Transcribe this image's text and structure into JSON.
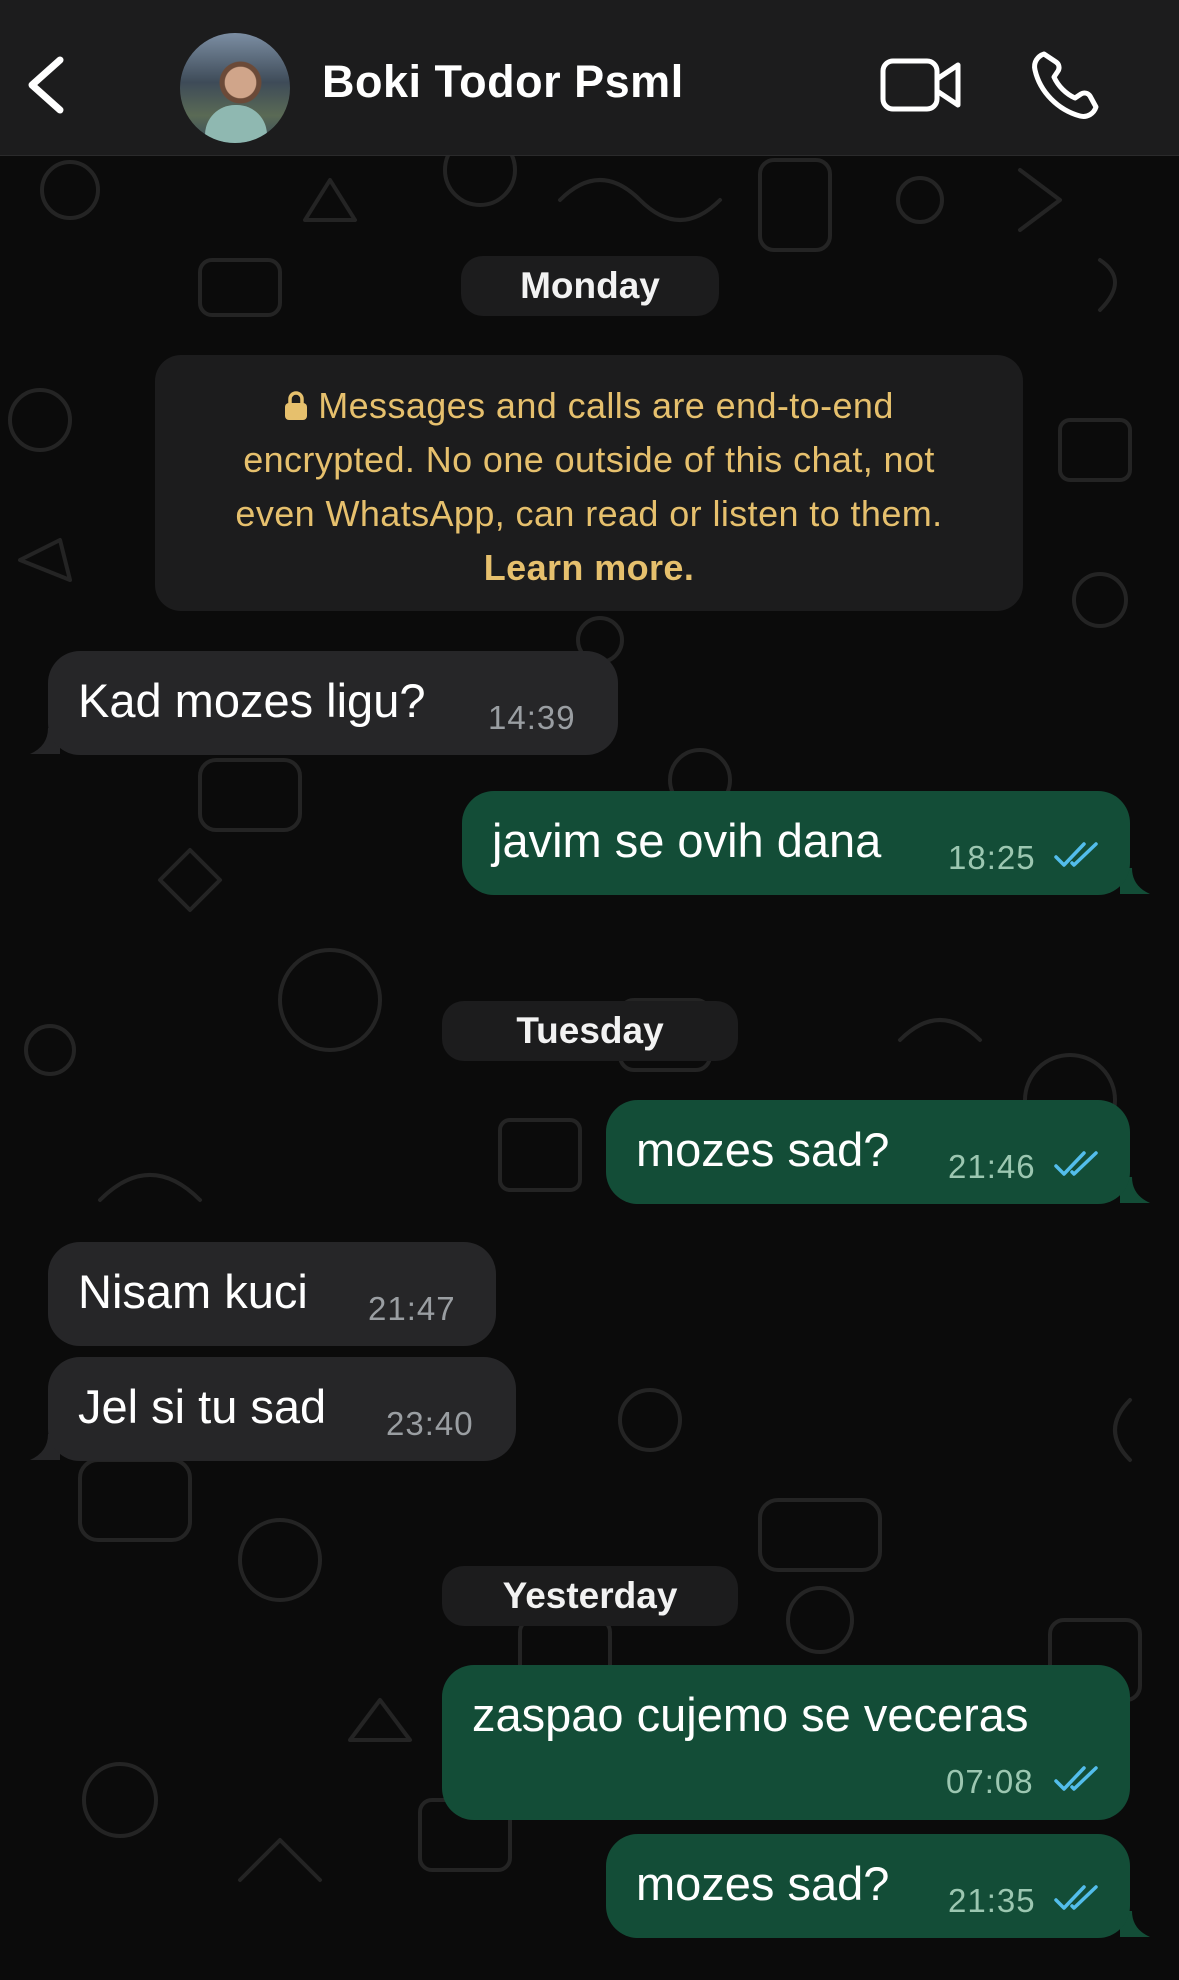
{
  "header": {
    "contact_name": "Boki Todor Psml",
    "back_icon": "chevron-left-icon",
    "video_icon": "video-camera-icon",
    "call_icon": "phone-icon"
  },
  "days": {
    "monday": "Monday",
    "tuesday": "Tuesday",
    "yesterday": "Yesterday"
  },
  "encryption": {
    "line1": "Messages and calls are end-to-end",
    "line2": "encrypted. No one outside of this chat, not",
    "line3": "even WhatsApp, can read or listen to them.",
    "learn_more": "Learn more."
  },
  "messages": [
    {
      "direction": "incoming",
      "text": "Kad mozes ligu?",
      "time": "14:39"
    },
    {
      "direction": "outgoing",
      "text": "javim se ovih dana",
      "time": "18:25",
      "status": "read"
    },
    {
      "direction": "outgoing",
      "text": "mozes sad?",
      "time": "21:46",
      "status": "read"
    },
    {
      "direction": "incoming",
      "text": "Nisam kuci",
      "time": "21:47"
    },
    {
      "direction": "incoming",
      "text": "Jel si tu sad",
      "time": "23:40"
    },
    {
      "direction": "outgoing",
      "text": "zaspao cujemo se veceras",
      "time": "07:08",
      "status": "read"
    },
    {
      "direction": "outgoing",
      "text": "mozes sad?",
      "time": "21:35",
      "status": "read"
    }
  ],
  "colors": {
    "header_bg": "#1c1c1d",
    "incoming_bubble": "#262628",
    "outgoing_bubble": "#134d37",
    "encryption_text": "#e6c06d",
    "read_tick": "#53bdeb"
  }
}
